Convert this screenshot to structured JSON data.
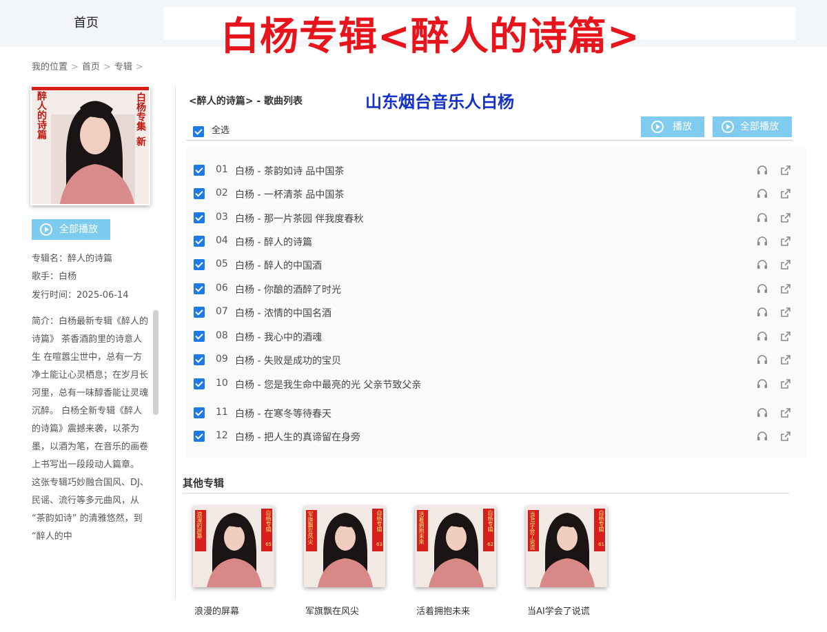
{
  "nav": {
    "home_label": "首页"
  },
  "banner": {
    "title": "白杨专辑<醉人的诗篇>"
  },
  "breadcrumb": {
    "label": "我的位置",
    "items": [
      "首页",
      "专辑"
    ],
    "separator": ">"
  },
  "album": {
    "cover_text_left": "醉人的诗篇",
    "cover_text_right": "白杨专集",
    "cover_badge": "新",
    "play_all_label": "全部播放",
    "name_label": "专辑名：",
    "name_value": "醉人的诗篇",
    "singer_label": "歌手：",
    "singer_value": "白杨",
    "release_label": "发行时间：",
    "release_value": "2025-06-14",
    "intro": "简介：白杨最新专辑《醉人的诗篇》 茶香酒韵里的诗意人生 在喧嚣尘世中，总有一方净土能让心灵栖息；在岁月长河里，总有一味醇香能让灵魂沉醉。 白杨全新专辑《醉人的诗篇》震撼来袭，以茶为墨，以酒为笔，在音乐的画卷上书写出一段段动人篇章。 这张专辑巧妙融合国风、DJ、民谣、流行等多元曲风，从 “茶韵如诗” 的清雅悠然，到 “醉人的中"
  },
  "song_list": {
    "title": "<醉人的诗篇> - 歌曲列表",
    "artist_tag": "山东烟台音乐人白杨",
    "select_all_label": "全选",
    "play_label": "播放",
    "play_all_label": "全部播放",
    "songs": [
      {
        "num": "01",
        "name": "白杨 - 茶韵如诗 品中国茶"
      },
      {
        "num": "02",
        "name": "白杨 - 一杯清茶 品中国茶"
      },
      {
        "num": "03",
        "name": "白杨 - 那一片茶园 伴我度春秋"
      },
      {
        "num": "04",
        "name": "白杨 - 醉人的诗篇"
      },
      {
        "num": "05",
        "name": "白杨 - 醉人的中国酒"
      },
      {
        "num": "06",
        "name": "白杨 - 你酿的酒醉了时光"
      },
      {
        "num": "07",
        "name": "白杨 - 浓情的中国名酒"
      },
      {
        "num": "08",
        "name": "白杨 - 我心中的酒魂"
      },
      {
        "num": "09",
        "name": "白杨 - 失败是成功的宝贝"
      },
      {
        "num": "10",
        "name": "白杨 - 您是我生命中最亮的光 父亲节致父亲"
      },
      {
        "num": "11",
        "name": "白杨 - 在寒冬等待春天"
      },
      {
        "num": "12",
        "name": "白杨 - 把人生的真谛留在身旁"
      }
    ]
  },
  "other_albums": {
    "title": "其他专辑",
    "items": [
      {
        "name": "浪漫的屏幕",
        "cover_left": "浪漫的屏幕",
        "cover_right": "白杨专辑",
        "cover_num": "65"
      },
      {
        "name": "军旗飘在风尖",
        "cover_left": "军旗飘在风尖",
        "cover_right": "白杨专辑",
        "cover_num": "63"
      },
      {
        "name": "活着拥抱未来",
        "cover_left": "活着拥抱未来",
        "cover_right": "白杨专辑",
        "cover_num": "62"
      },
      {
        "name": "当AI学会了说谎",
        "cover_left": "当AI学会了说谎",
        "cover_right": "白杨专辑",
        "cover_num": "61"
      }
    ]
  },
  "colors": {
    "title_red": "#e8141b",
    "artist_blue": "#1432c8",
    "button_blue": "#80cbf0",
    "checkbox_blue": "#1f7ae6"
  }
}
